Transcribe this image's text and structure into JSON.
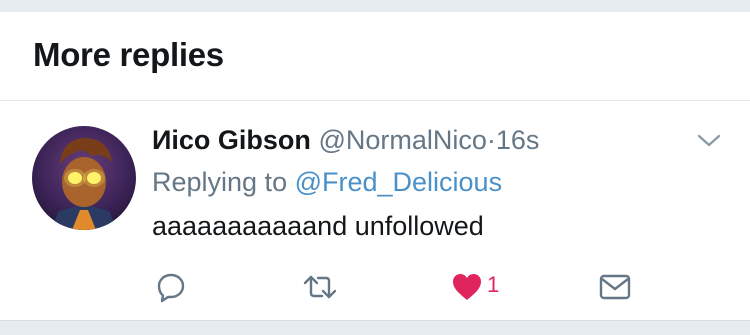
{
  "section": {
    "title": "More replies"
  },
  "tweet": {
    "display_name": "Иico Gibson",
    "handle": "@NormalNico",
    "separator": "·",
    "time": "16s",
    "replying_prefix": "Replying to ",
    "replying_to": "@Fred_Delicious",
    "text": "aaaaaaaaaaand unfollowed",
    "like_count": "1"
  },
  "icons": {
    "caret": "chevron-down-icon",
    "reply": "reply-icon",
    "retweet": "retweet-icon",
    "like": "heart-icon",
    "dm": "envelope-icon"
  },
  "colors": {
    "background": "#e6ecf0",
    "text": "#14171a",
    "secondary": "#657786",
    "link": "#4a90c9",
    "like": "#e0245e"
  }
}
